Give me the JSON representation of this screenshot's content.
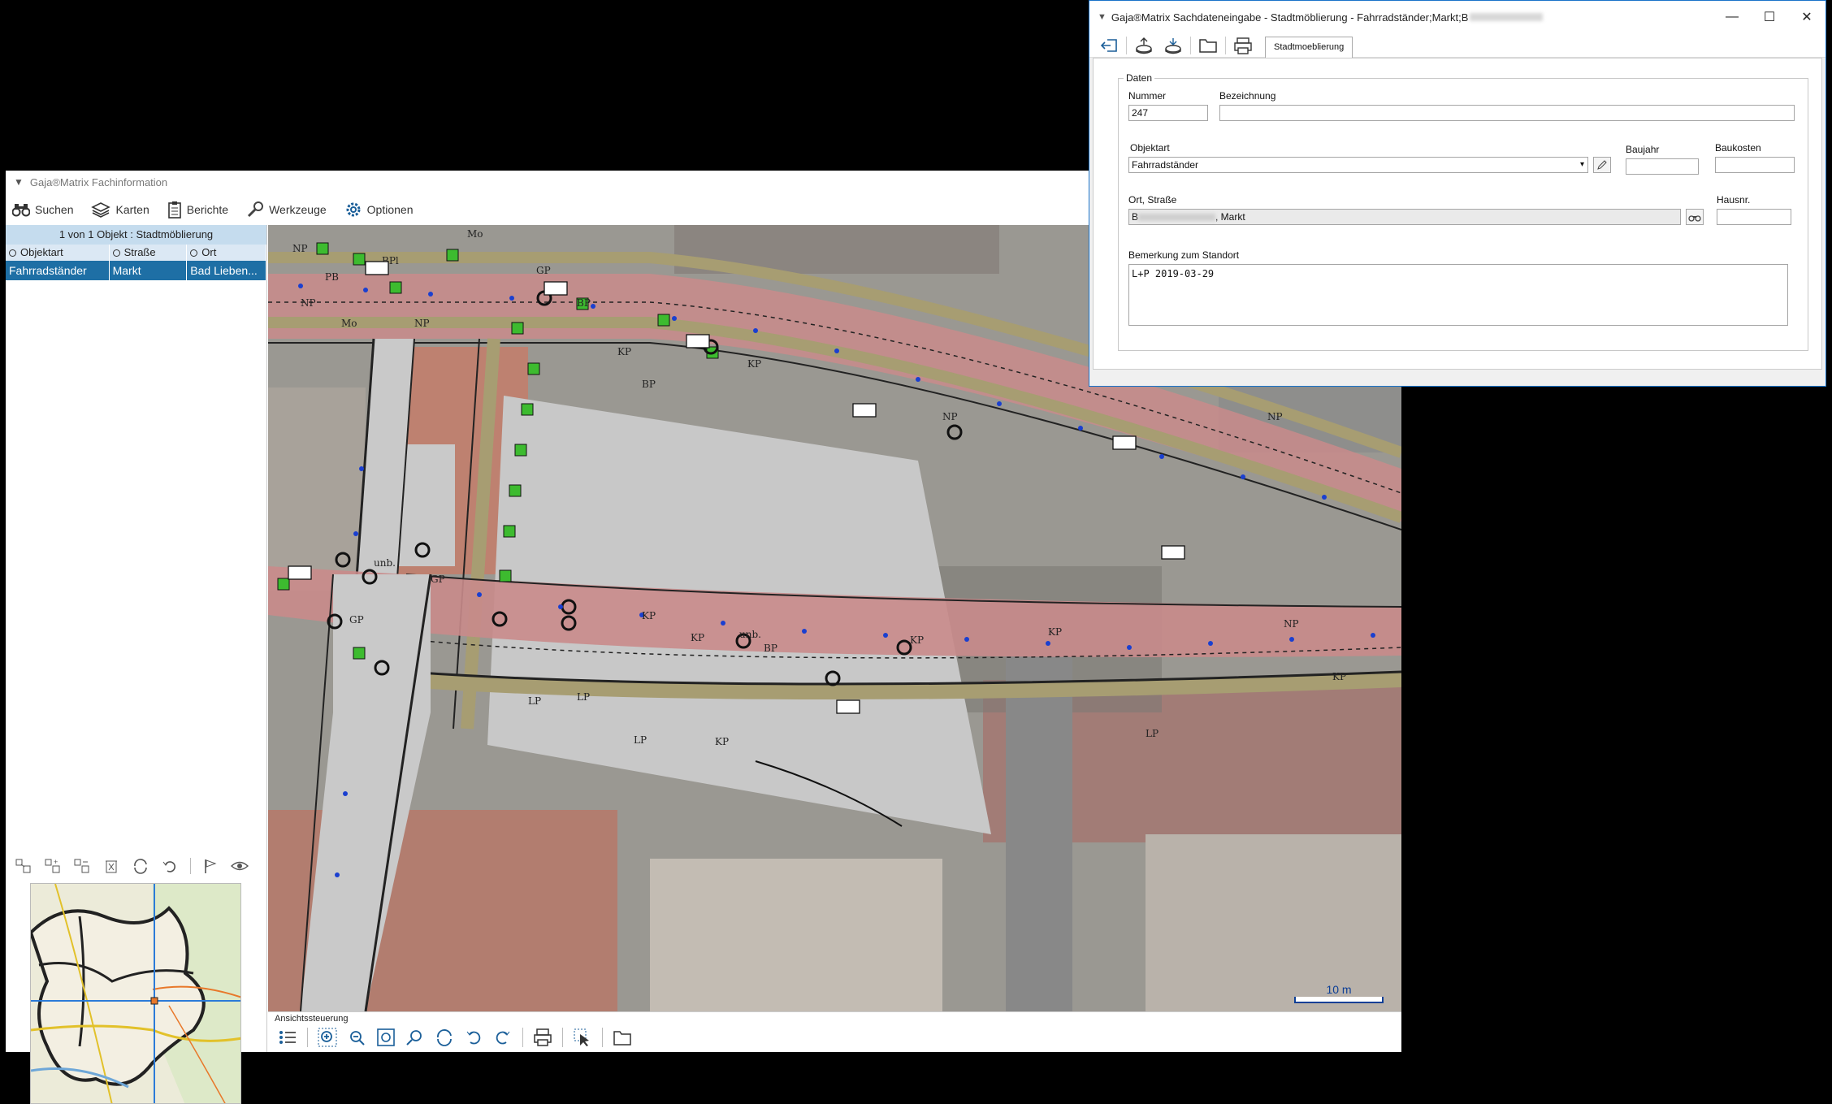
{
  "main_window": {
    "title": "Gaja®Matrix Fachinformation",
    "toolbar": {
      "search_label": "Suchen",
      "maps_label": "Karten",
      "reports_label": "Berichte",
      "tools_label": "Werkzeuge",
      "options_label": "Optionen"
    },
    "results": {
      "header": "1 von 1 Objekt : Stadtmöblierung",
      "columns": [
        "Objektart",
        "Straße",
        "Ort"
      ],
      "rows": [
        {
          "objektart": "Fahrradständer",
          "strasse": "Markt",
          "ort": "Bad Lieben..."
        }
      ]
    },
    "view_control": {
      "label": "Ansichtssteuerung"
    },
    "scale": {
      "label": "10 m"
    },
    "map_labels": [
      "NP",
      "GF",
      "Mo",
      "BPl",
      "PB",
      "GP",
      "LP",
      "KP",
      "unb.",
      "BP",
      "LF",
      "FB",
      "LP",
      "KP"
    ]
  },
  "dialog": {
    "title": "Gaja®Matrix Sachdateneingabe - Stadtmöblierung - Fahrradständer;Markt;B",
    "tab_label": "Stadtmoeblierung",
    "group_label": "Daten",
    "fields": {
      "nummer_label": "Nummer",
      "nummer_value": "247",
      "bezeichnung_label": "Bezeichnung",
      "bezeichnung_value": "",
      "objektart_label": "Objektart",
      "objektart_value": "Fahrradständer",
      "baujahr_label": "Baujahr",
      "baujahr_value": "",
      "baukosten_label": "Baukosten",
      "baukosten_value": "",
      "ort_strasse_label": "Ort, Straße",
      "ort_strasse_prefix": "B",
      "ort_strasse_suffix": ", Markt",
      "hausnr_label": "Hausnr.",
      "hausnr_value": "",
      "bemerkung_label": "Bemerkung zum Standort",
      "bemerkung_value": "L+P 2019-03-29"
    }
  },
  "colors": {
    "accent": "#1e6fa5",
    "header_bg": "#c5dcee",
    "road_pink": "#c98b8b",
    "road_olive": "#a79d72",
    "green_marker": "#3dbb2f",
    "lane_blue": "#1a3fd0"
  }
}
